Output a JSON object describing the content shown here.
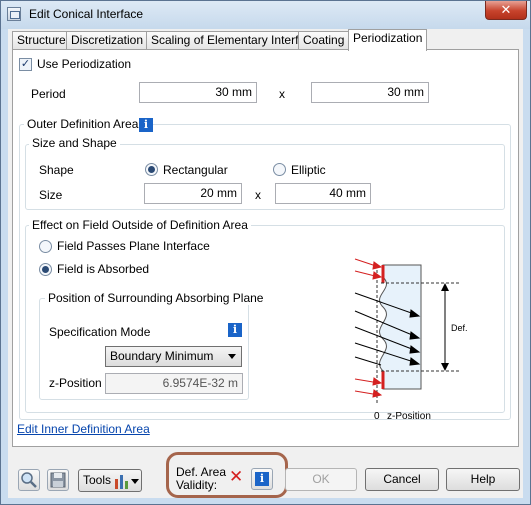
{
  "window": {
    "title": "Edit Conical Interface",
    "close_label": "✕"
  },
  "tabs": [
    "Structure",
    "Discretization",
    "Scaling of Elementary Interface",
    "Coating",
    "Periodization"
  ],
  "periodization": {
    "use_label": "Use Periodization",
    "use_checked": true,
    "period_label": "Period",
    "period_x": "30 mm",
    "separator": "x",
    "period_y": "30 mm"
  },
  "outer": {
    "title": "Outer Definition Area",
    "size_shape": {
      "title": "Size and Shape",
      "shape_label": "Shape",
      "shape_options": [
        "Rectangular",
        "Elliptic"
      ],
      "selected_shape": "Rectangular",
      "size_label": "Size",
      "size_x": "20 mm",
      "separator": "x",
      "size_y": "40 mm"
    },
    "effect": {
      "title": "Effect on Field Outside of Definition Area",
      "options": [
        "Field Passes Plane Interface",
        "Field is Absorbed"
      ],
      "selected": "Field is Absorbed",
      "absorbing": {
        "title": "Position of Surrounding Absorbing Plane",
        "mode_label": "Specification Mode",
        "mode_value": "Boundary Minimum",
        "zpos_label": "z-Position",
        "zpos_value": "6.9574E-32 m"
      }
    },
    "diagram": {
      "def_area_label": "Def. Area",
      "zero_label": "0",
      "zpos_label": "z-Position"
    }
  },
  "inner_link": "Edit Inner Definition Area",
  "footer": {
    "tools_label": "Tools",
    "validity_label": "Def. Area Validity:",
    "validity_icon": "✕",
    "ok_label": "OK",
    "cancel_label": "Cancel",
    "help_label": "Help"
  },
  "colors": {
    "accent_red": "#d42020",
    "info_blue": "#1a64c8",
    "highlight": "#a5654c",
    "diagram_fill": "#e7f2fb"
  }
}
